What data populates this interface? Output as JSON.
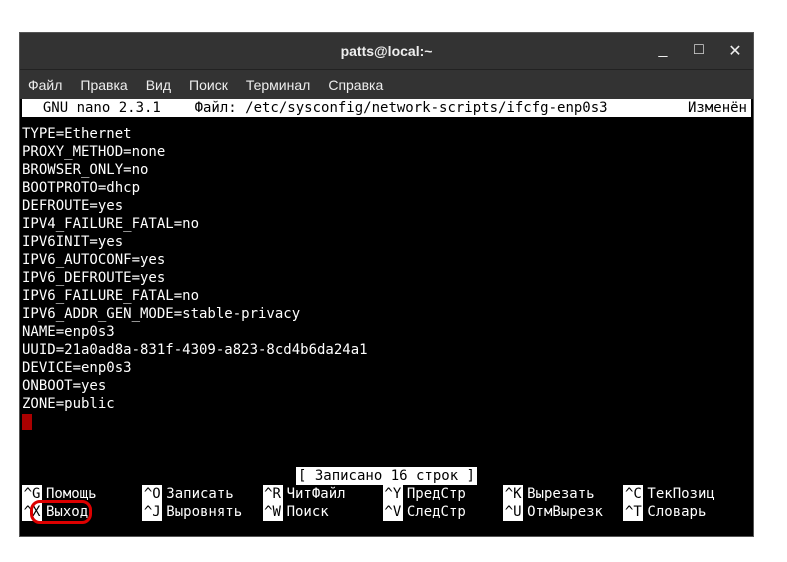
{
  "window": {
    "title": "patts@local:~"
  },
  "menubar": [
    "Файл",
    "Правка",
    "Вид",
    "Поиск",
    "Терминал",
    "Справка"
  ],
  "nano": {
    "app": "  GNU nano 2.3.1",
    "file_label": "Файл: /etc/sysconfig/network-scripts/ifcfg-enp0s3",
    "modified": "Изменён"
  },
  "file_lines": [
    "TYPE=Ethernet",
    "PROXY_METHOD=none",
    "BROWSER_ONLY=no",
    "BOOTPROTO=dhcp",
    "DEFROUTE=yes",
    "IPV4_FAILURE_FATAL=no",
    "IPV6INIT=yes",
    "IPV6_AUTOCONF=yes",
    "IPV6_DEFROUTE=yes",
    "IPV6_FAILURE_FATAL=no",
    "IPV6_ADDR_GEN_MODE=stable-privacy",
    "NAME=enp0s3",
    "UUID=21a0ad8a-831f-4309-a823-8cd4b6da24a1",
    "DEVICE=enp0s3",
    "ONBOOT=yes",
    "ZONE=public"
  ],
  "status": "[ Записано 16 строк ]",
  "shortcuts_row1": [
    {
      "key": "^G",
      "label": "Помощь"
    },
    {
      "key": "^O",
      "label": "Записать"
    },
    {
      "key": "^R",
      "label": "ЧитФайл"
    },
    {
      "key": "^Y",
      "label": "ПредСтр"
    },
    {
      "key": "^K",
      "label": "Вырезать"
    },
    {
      "key": "^C",
      "label": "ТекПозиц"
    }
  ],
  "shortcuts_row2": [
    {
      "key": "^X",
      "label": "Выход"
    },
    {
      "key": "^J",
      "label": "Выровнять"
    },
    {
      "key": "^W",
      "label": "Поиск"
    },
    {
      "key": "^V",
      "label": "СледСтр"
    },
    {
      "key": "^U",
      "label": "ОтмВырезк"
    },
    {
      "key": "^T",
      "label": "Словарь"
    }
  ]
}
